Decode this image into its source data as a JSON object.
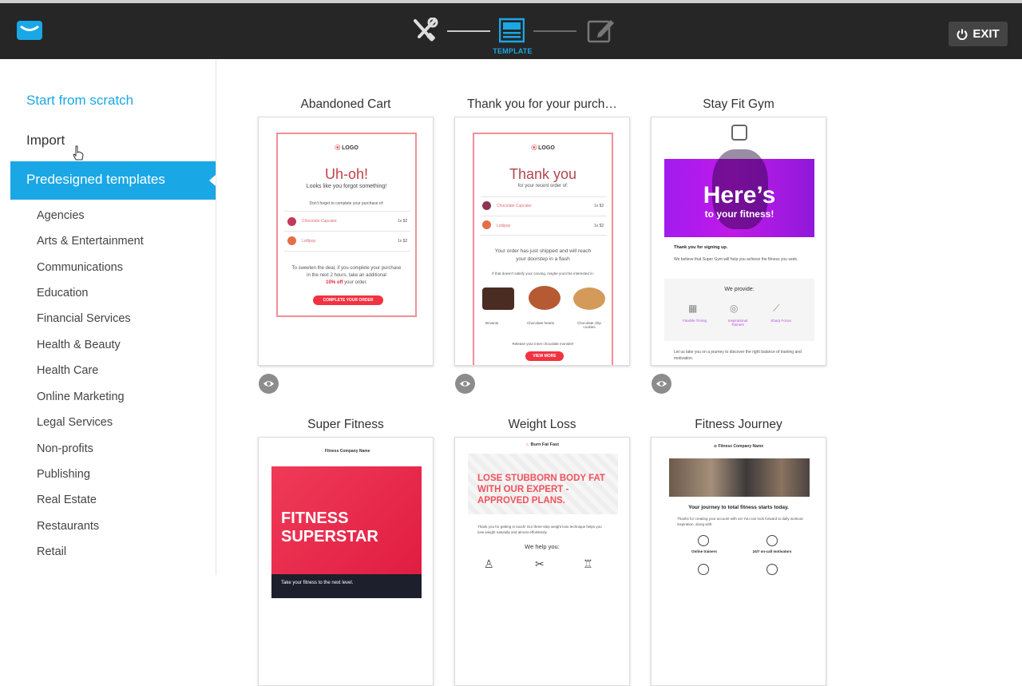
{
  "header": {
    "step_label": "TEMPLATE",
    "exit_label": "EXIT",
    "accent": "#1aa7e6"
  },
  "sidebar": {
    "start_from_scratch": "Start from scratch",
    "import": "Import",
    "predesigned": "Predesigned templates",
    "categories": [
      "Agencies",
      "Arts & Entertainment",
      "Communications",
      "Education",
      "Financial Services",
      "Health & Beauty",
      "Health Care",
      "Online Marketing",
      "Legal Services",
      "Non-profits",
      "Publishing",
      "Real Estate",
      "Restaurants",
      "Retail"
    ]
  },
  "templates": [
    {
      "title": "Abandoned Cart",
      "logo": "LOGO",
      "headline": "Uh-oh!",
      "subhead": "Looks like you forgot something!",
      "note": "Don't forget to complete your purchase of:",
      "items": [
        {
          "name": "Chocolate Cupcake",
          "qty": "1x $2"
        },
        {
          "name": "Lollipop",
          "qty": "1x $2"
        }
      ],
      "body_1": "To sweeten the deal, if you complete your purchase",
      "body_2": "in the next 2 hours, take an additional",
      "body_3": "10% off",
      "body_4": "your order.",
      "cta": "COMPLETE YOUR ORDER"
    },
    {
      "title": "Thank you for your purch…",
      "logo": "LOGO",
      "headline": "Thank you",
      "subhead": "for your recent order of:",
      "items": [
        {
          "name": "Chocolate Cupcake",
          "qty": "1x $2"
        },
        {
          "name": "Lollipop",
          "qty": "1x $2"
        }
      ],
      "body_1": "Your order has just shipped and will reach",
      "body_2": "your doorstep in a flash",
      "note": "If that doesn't satisfy your craving, maybe you'd be interested in:",
      "products": [
        "Brownie",
        "Chocolate hearts",
        "Chocolate chip cookies"
      ],
      "footer_note": "Release your inner chocolate monster!",
      "cta": "VIEW MORE"
    },
    {
      "title": "Stay Fit Gym",
      "hero_1": "Here’s",
      "hero_2": "to your fitness!",
      "thanks": "Thank you for signing up.",
      "body": "We believe that Super Gym will help you achieve the fitness you seek.",
      "provide": "We provide:",
      "features": [
        "Flexible Timing",
        "Inspirational Trainers",
        "Sharp Focus"
      ],
      "footer": "Let us take you on a journey to discover the right balance of training and motivation."
    },
    {
      "title": "Super Fitness",
      "company": "Fitness Company Name",
      "hero": "FITNESS SUPERSTAR",
      "tagline": "Take your fitness to the next level."
    },
    {
      "title": "Weight Loss",
      "brand": "Burn Fat Fast",
      "headline": "LOSE STUBBORN BODY FAT WITH OUR EXPERT -APPROVED PLANS.",
      "body": "Thank you for getting in touch! Our three-step weight loss technique helps you lose weight naturally and almost effortlessly.",
      "help": "We help you:"
    },
    {
      "title": "Fitness Journey",
      "company": "Fitness Company Name",
      "headline": "Your journey to total fitness starts today.",
      "body": "Thanks for creating your account with us! You can look forward to daily workout inspiration, along with:",
      "features": [
        "Online trainers",
        "24/7 on-call motivators"
      ]
    }
  ]
}
